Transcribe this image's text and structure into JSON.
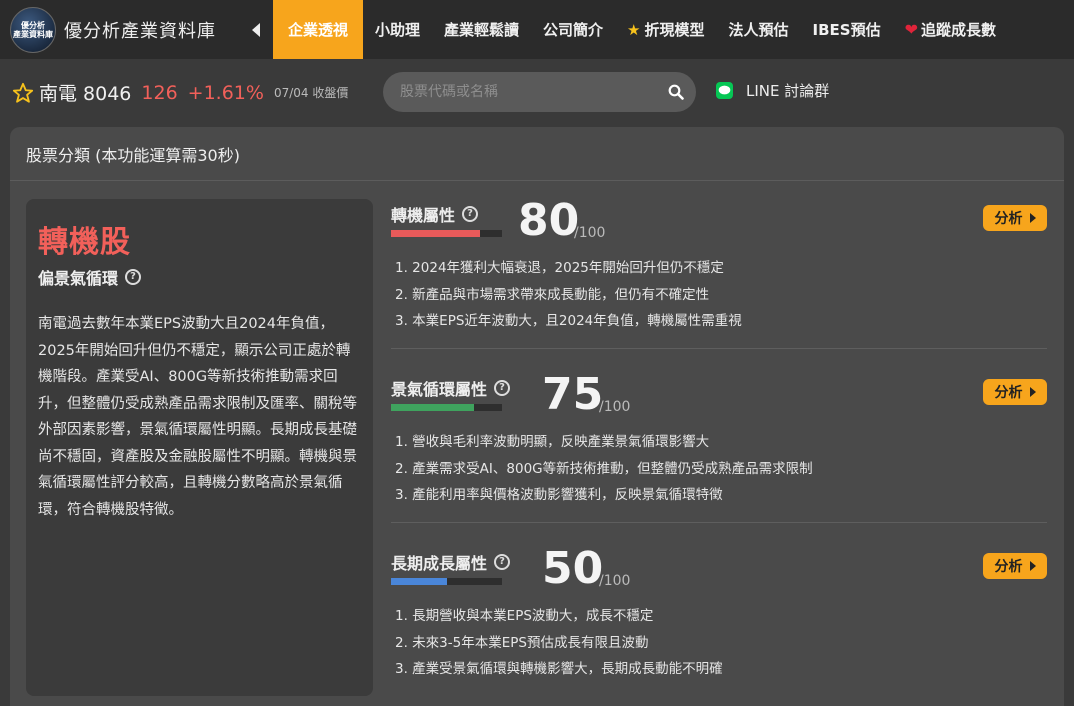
{
  "nav": {
    "logo_text": "優分析\n產業資料庫",
    "brand": "優分析產業資料庫",
    "tabs": [
      {
        "label": "企業透視",
        "active": true
      },
      {
        "label": "小助理"
      },
      {
        "label": "產業輕鬆讀"
      },
      {
        "label": "公司簡介"
      },
      {
        "label": "折現模型",
        "icon": "star-icon"
      },
      {
        "label": "法人預估"
      },
      {
        "label": "IBES預估"
      },
      {
        "label": "追蹤成長數",
        "icon": "heart-icon"
      }
    ]
  },
  "stock": {
    "name": "南電 8046",
    "price": "126",
    "change": "+1.61%",
    "close_label": "07/04 收盤價"
  },
  "search": {
    "placeholder": "股票代碼或名稱"
  },
  "line": {
    "label": "LINE 討論群"
  },
  "panel": {
    "title": "股票分類 (本功能運算需30秒)",
    "summary": {
      "category": "轉機股",
      "subcategory": "偏景氣循環",
      "description": "南電過去數年本業EPS波動大且2024年負值，2025年開始回升但仍不穩定，顯示公司正處於轉機階段。產業受AI、800G等新技術推動需求回升，但整體仍受成熟產品需求限制及匯率、關稅等外部因素影響，景氣循環屬性明顯。長期成長基礎尚不穩固，資產股及金融股屬性不明顯。轉機與景氣循環屬性評分較高，且轉機分數略高於景氣循環，符合轉機股特徵。"
    },
    "metrics": [
      {
        "title": "轉機屬性",
        "score": 80,
        "max_label": "/100",
        "color": "#e85a5a",
        "button": "分析",
        "points": [
          "1. 2024年獲利大幅衰退，2025年開始回升但仍不穩定",
          "2. 新產品與市場需求帶來成長動能，但仍有不確定性",
          "3. 本業EPS近年波動大，且2024年負值，轉機屬性需重視"
        ]
      },
      {
        "title": "景氣循環屬性",
        "score": 75,
        "max_label": "/100",
        "color": "#3fa35e",
        "button": "分析",
        "points": [
          "1. 營收與毛利率波動明顯，反映產業景氣循環影響大",
          "2. 產業需求受AI、800G等新技術推動，但整體仍受成熟產品需求限制",
          "3. 產能利用率與價格波動影響獲利，反映景氣循環特徵"
        ]
      },
      {
        "title": "長期成長屬性",
        "score": 50,
        "max_label": "/100",
        "color": "#4a86d9",
        "button": "分析",
        "points": [
          "1. 長期營收與本業EPS波動大，成長不穩定",
          "2. 未來3-5年本業EPS預估成長有限且波動",
          "3. 產業受景氣循環與轉機影響大，長期成長動能不明確"
        ]
      }
    ]
  }
}
